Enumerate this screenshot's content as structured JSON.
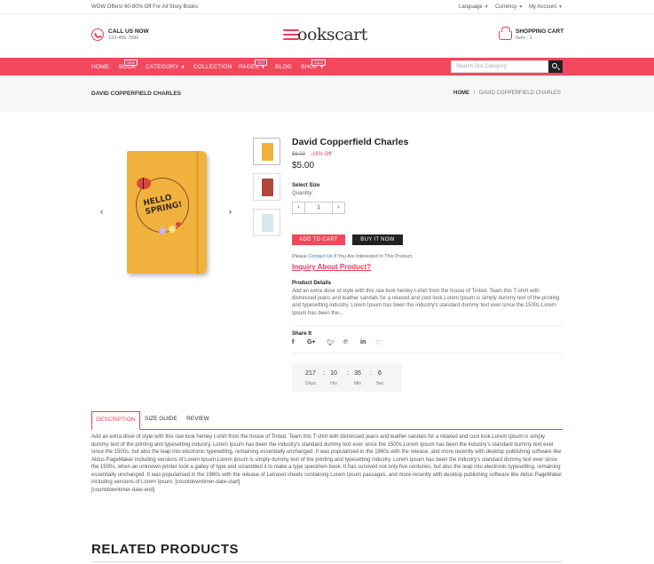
{
  "topbar": {
    "offer": "WOW Offers! 60-80% Off For All Story Books",
    "language": "Language",
    "currency": "Currency",
    "account": "My Account"
  },
  "header": {
    "call_title": "CALL US NOW",
    "call_number": "123-456-7890",
    "logo_text": "ookscart",
    "cart_title": "SHOPPING CART",
    "cart_items": "Item - 1"
  },
  "nav": {
    "items": [
      "HOME",
      "BOOK",
      "CATEGORY",
      "COLLECTION",
      "PAGES",
      "BLOG",
      "SHOP"
    ],
    "badges": {
      "book": "NEW",
      "pages": "HOT",
      "shop": "SALE"
    },
    "search_placeholder": "Search Our Category"
  },
  "breadcrumb": {
    "page_title": "DAVID COPPERFIELD CHARLES",
    "home": "HOME",
    "separator": "/",
    "current": "DAVID COPPERFIELD CHARLES"
  },
  "product": {
    "cover_text": "HELLO SPRING!",
    "title": "David Copperfield Charles",
    "old_price": "$6.00",
    "discount": "-16% Off",
    "price": "$5.00",
    "select_size": "Select Size",
    "quantity_label": "Quantity:",
    "quantity": "1",
    "minus": "‹",
    "plus": "›",
    "add_to_cart": "ADD TO CART",
    "buy_now": "BUY IT NOW",
    "please_prefix": "Please",
    "contact_link": "Contact Us",
    "please_suffix": "If You Are Interested In This Product.",
    "inquiry": "Inquiry About Product?",
    "details_title": "Product Details",
    "details_text": "Add an extra dose of style with this raw look henley t-shirt from the house of Tinted. Team this T-shirt with distressed jeans and leather sandals for a relaxed and cool look.Lorem Ipsum is simply dummy text of the printing and typesetting industry. Lorem Ipsum has been the industry's standard dummy text ever since the 1500s.Lorem Ipsum has been the...",
    "share_title": "Share It"
  },
  "countdown": {
    "days": "217",
    "hrs": "10",
    "min": "35",
    "sec": "6",
    "days_label": "Days",
    "hrs_label": "Hrs",
    "min_label": "Min",
    "sec_label": "Sec"
  },
  "tabs": [
    "DESCRIPTION",
    "SIZE GUIDE",
    "REVIEW"
  ],
  "description": "Add an extra dose of style with this raw look henley t-shirt from the house of Tinted. Team this T-shirt with distressed jeans and leather sandals for a relaxed and cool look.Lorem Ipsum is simply dummy text of the printing and typesetting industry. Lorem Ipsum has been the industry's standard dummy text ever since the 1500s.Lorem Ipsum has been the industry's standard dummy text ever since the 1500s, but also the leap into electronic typesetting, remaining essentially unchanged. It was popularised in the 1960s with the release, and more recently with desktop publishing software like Aldus PageMaker including versions of Lorem Ipsum.Lorem Ipsum is simply dummy text of the printing and typesetting industry. Lorem Ipsum has been the industry's standard dummy text ever since the 1500s, when an unknown printer took a galley of type and scrambled it to make a type specimen book. It has survived not only five centuries, but also the leap into electronic typesetting, remaining essentially unchanged. It was popularised in the 1960s with the release of Letraset sheets containing Lorem Ipsum passages, and more recently with desktop publishing software like Aldus PageMaker including versions of Lorem Ipsum. [countdowntimer-date-start]",
  "description_end": "[countdowntimer-date-end]",
  "related_title": "RELATED PRODUCTS",
  "colors": {
    "accent": "#f2485d",
    "dark": "#222222",
    "book": "#f0b23d"
  }
}
